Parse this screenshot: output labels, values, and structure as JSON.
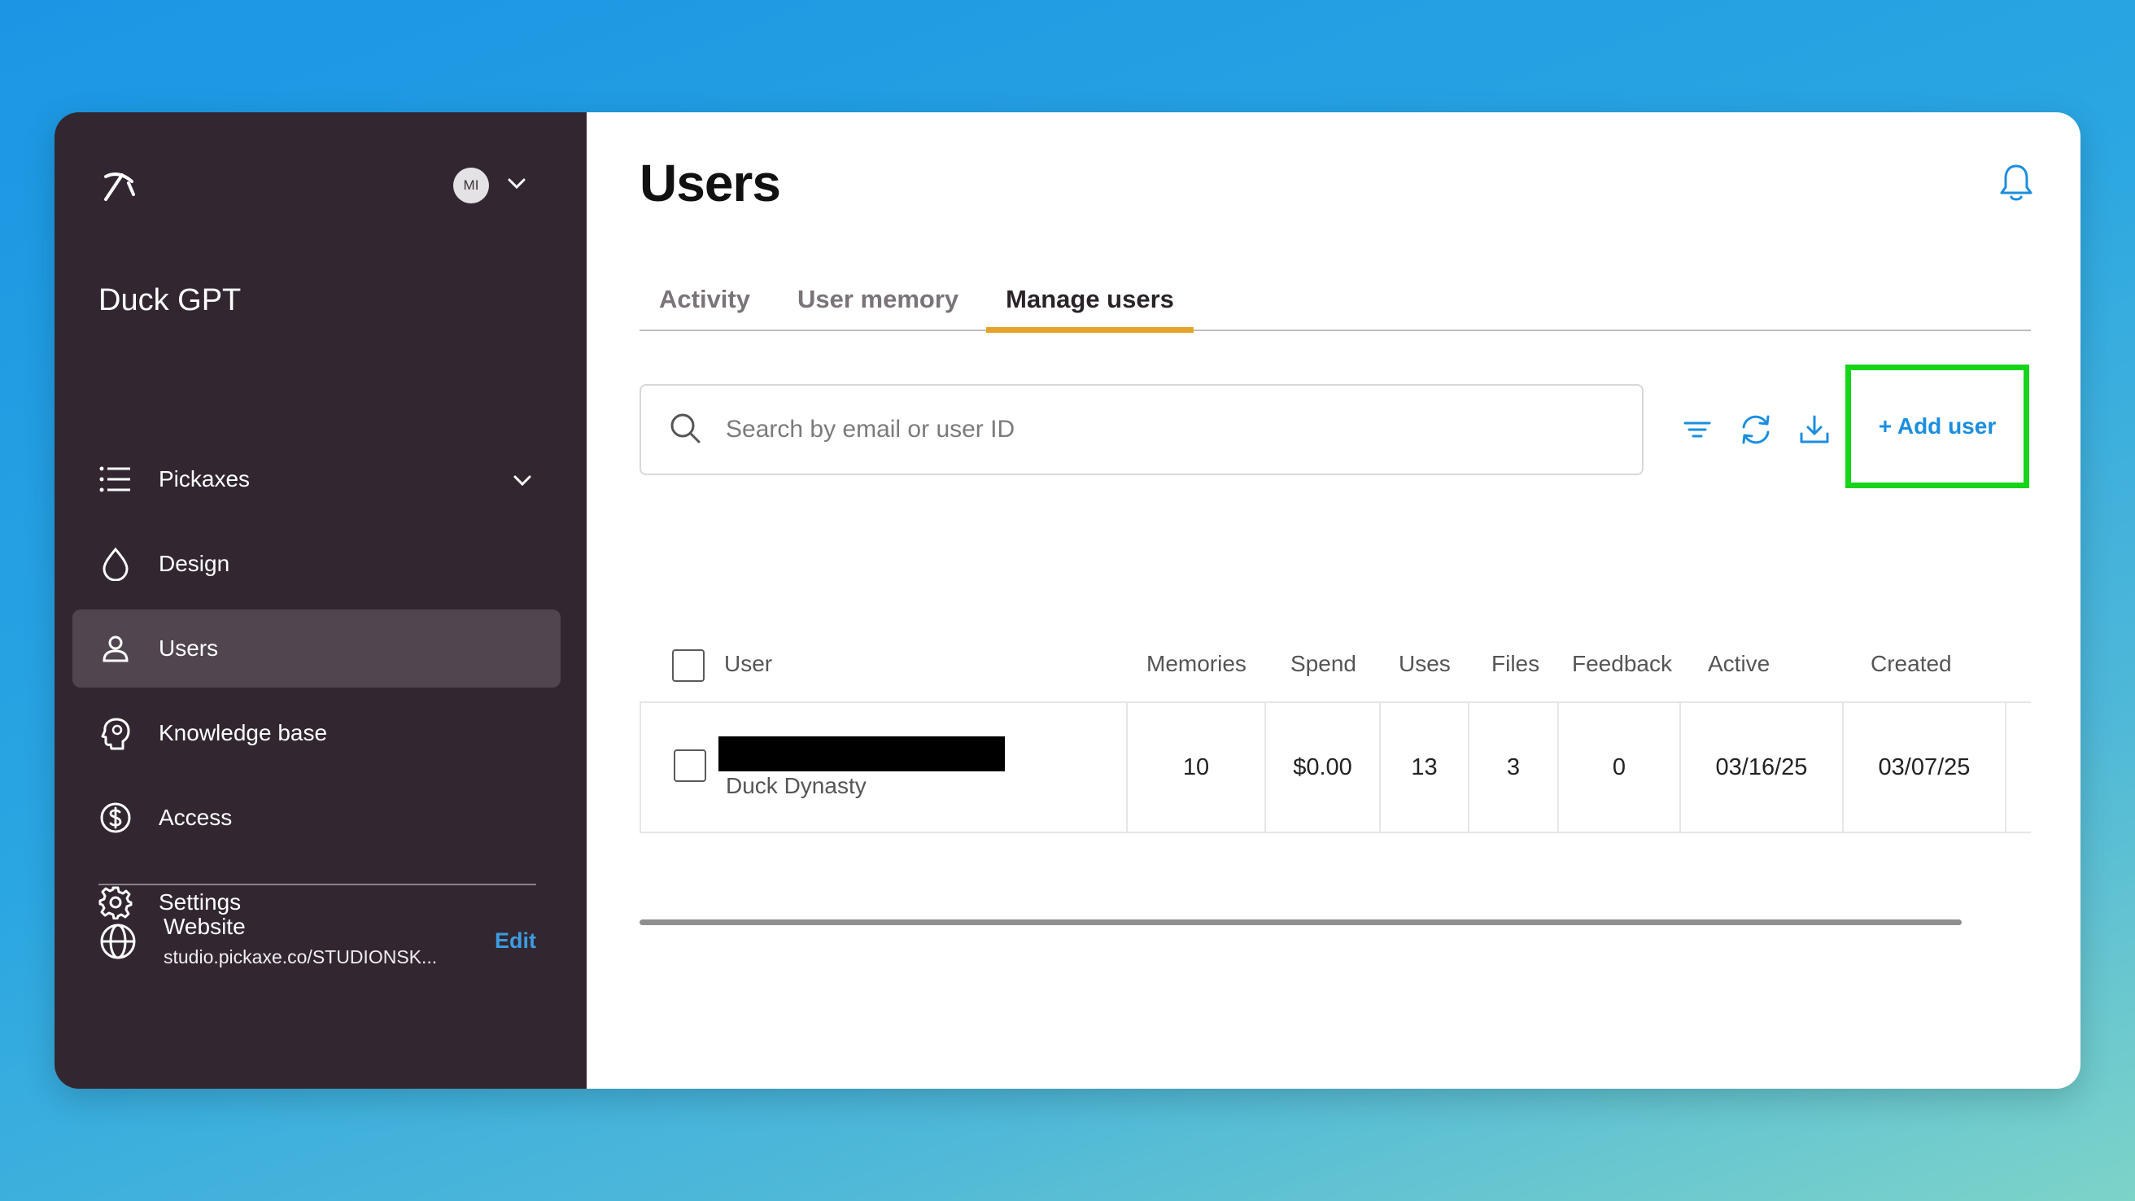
{
  "sidebar": {
    "account": {
      "initials": "MI"
    },
    "app_name": "Duck GPT",
    "items": [
      {
        "label": "Pickaxes",
        "icon": "list-icon"
      },
      {
        "label": "Design",
        "icon": "droplet-icon"
      },
      {
        "label": "Users",
        "icon": "user-icon",
        "active": true
      },
      {
        "label": "Knowledge base",
        "icon": "brain-icon"
      },
      {
        "label": "Access",
        "icon": "dollar-icon"
      },
      {
        "label": "Settings",
        "icon": "gear-icon"
      }
    ],
    "website": {
      "title": "Website",
      "url": "studio.pickaxe.co/STUDIONSK...",
      "edit_label": "Edit"
    }
  },
  "main": {
    "title": "Users",
    "tabs": [
      {
        "label": "Activity"
      },
      {
        "label": "User memory"
      },
      {
        "label": "Manage users",
        "active": true
      }
    ],
    "search": {
      "placeholder": "Search by email or user ID"
    },
    "add_user_label": "+ Add user",
    "table": {
      "headers": {
        "user": "User",
        "memories": "Memories",
        "spend": "Spend",
        "uses": "Uses",
        "files": "Files",
        "feedback": "Feedback",
        "active": "Active",
        "created": "Created"
      },
      "rows": [
        {
          "user_name": "Duck Dynasty",
          "memories": "10",
          "spend": "$0.00",
          "uses": "13",
          "files": "3",
          "feedback": "0",
          "active": "03/16/25",
          "created": "03/07/25"
        }
      ]
    }
  },
  "colors": {
    "sidebar_bg": "#322731",
    "accent_tab": "#e3a32a",
    "link_blue": "#1b8ee0",
    "highlight_green": "#16d41a"
  }
}
